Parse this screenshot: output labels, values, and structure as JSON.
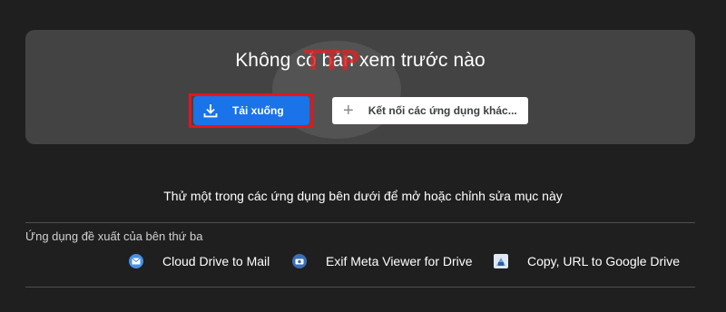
{
  "preview": {
    "title": "Không có bản xem trước nào",
    "download_label": "Tải xuống",
    "connect_label": "Kết nối các ứng dụng khác..."
  },
  "watermark": {
    "text": "TTP"
  },
  "hint": "Thử một trong các ứng dụng bên dưới để mở hoặc chỉnh sửa mục này",
  "suggested": {
    "heading": "Ứng dụng đề xuất của bên thứ ba",
    "apps": [
      {
        "label": "Cloud Drive to Mail",
        "icon": "mail-icon",
        "color": "#4a90e2"
      },
      {
        "label": "Exif Meta Viewer for Drive",
        "icon": "camera-icon",
        "color": "#3b6fb6"
      },
      {
        "label": "Copy, URL to Google Drive",
        "icon": "copy-url-icon",
        "color": "#6aa0d8"
      }
    ]
  },
  "colors": {
    "accent": "#1a73e8",
    "highlight": "#e8141a"
  }
}
